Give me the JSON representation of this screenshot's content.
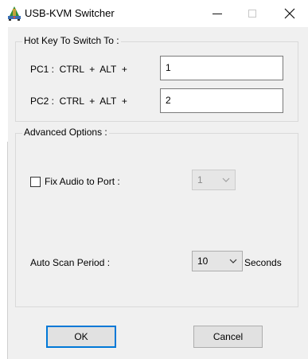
{
  "window": {
    "title": "USB-KVM Switcher",
    "icon": "usb-kvm-app-icon",
    "close_glyph": "✕"
  },
  "hotkey_group": {
    "label": "Hot Key To Switch To :",
    "pc1_label": "PC1 :  CTRL  +  ALT  +",
    "pc1_value": "1",
    "pc2_label": "PC2 :  CTRL  +  ALT  +",
    "pc2_value": "2"
  },
  "advanced_group": {
    "label": "Advanced Options :",
    "fix_audio_label": "Fix Audio to Port :",
    "fix_audio_checked": false,
    "audio_port_value": "1",
    "auto_scan_label": "Auto Scan Period :",
    "auto_scan_value": "10",
    "auto_scan_unit": "Seconds"
  },
  "buttons": {
    "ok": "OK",
    "cancel": "Cancel"
  },
  "colors": {
    "accent": "#0078d7",
    "dialog_bg": "#f0f0f0",
    "group_border": "#d9d9d9"
  }
}
